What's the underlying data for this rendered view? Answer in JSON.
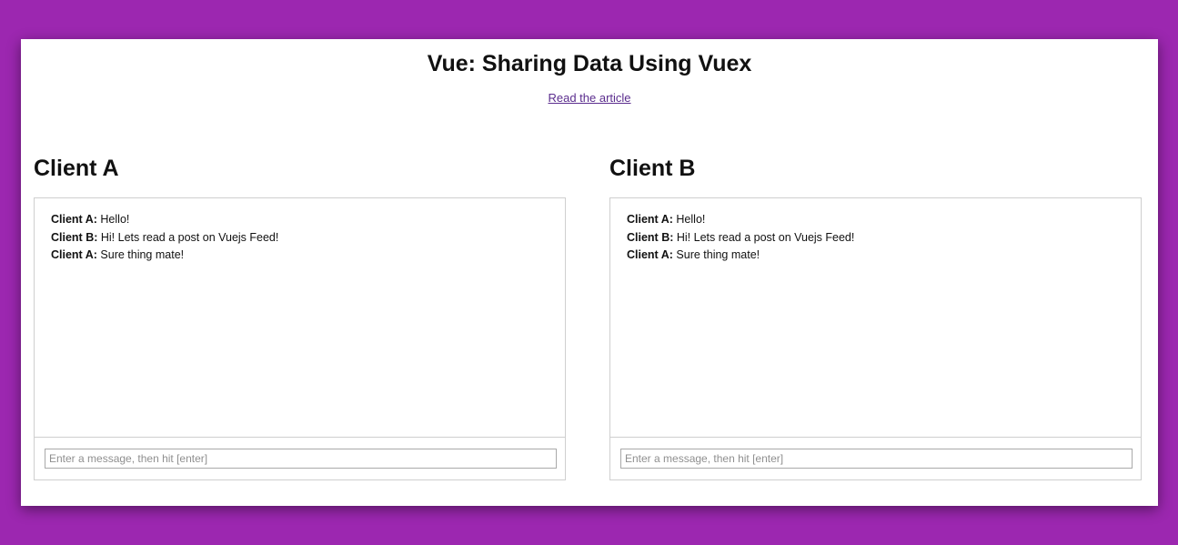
{
  "page": {
    "title": "Vue: Sharing Data Using Vuex",
    "link_text": "Read the article"
  },
  "colors": {
    "background": "#9c27b0",
    "card": "#ffffff",
    "link": "#5b2d8e"
  },
  "clients": [
    {
      "title": "Client A",
      "messages": [
        {
          "author": "Client A:",
          "text": "Hello!"
        },
        {
          "author": "Client B:",
          "text": "Hi! Lets read a post on Vuejs Feed!"
        },
        {
          "author": "Client A:",
          "text": "Sure thing mate!"
        }
      ],
      "input": {
        "placeholder": "Enter a message, then hit [enter]",
        "value": ""
      }
    },
    {
      "title": "Client B",
      "messages": [
        {
          "author": "Client A:",
          "text": "Hello!"
        },
        {
          "author": "Client B:",
          "text": "Hi! Lets read a post on Vuejs Feed!"
        },
        {
          "author": "Client A:",
          "text": "Sure thing mate!"
        }
      ],
      "input": {
        "placeholder": "Enter a message, then hit [enter]",
        "value": ""
      }
    }
  ]
}
